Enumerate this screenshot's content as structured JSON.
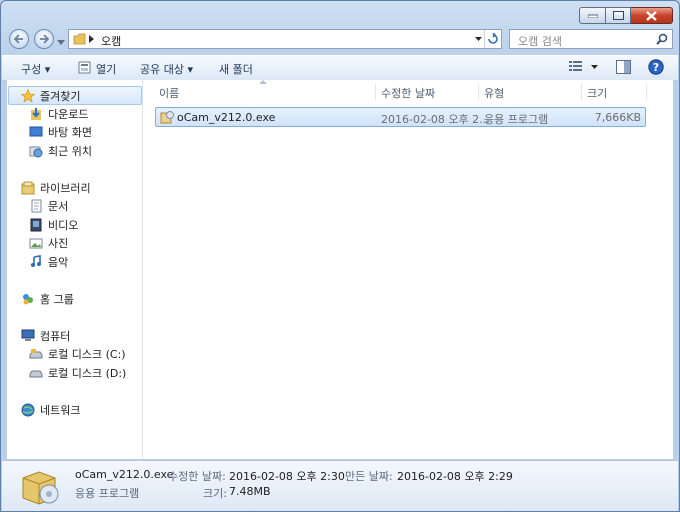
{
  "window": {
    "path_folder": "오캠"
  },
  "search": {
    "placeholder": "오캠 검색"
  },
  "toolbar": {
    "organize": "구성 ▾",
    "open": "열기",
    "share": "공유 대상 ▾",
    "new_folder": "새 폴더"
  },
  "nav": {
    "favorites": "즐겨찾기",
    "downloads": "다운로드",
    "desktop": "바탕 화면",
    "recent": "최근 위치",
    "libraries": "라이브러리",
    "documents": "문서",
    "videos": "비디오",
    "pictures": "사진",
    "music": "음악",
    "homegroup": "홈 그룹",
    "computer": "컴퓨터",
    "drive_c": "로컬 디스크 (C:)",
    "drive_d": "로컬 디스크 (D:)",
    "network": "네트워크"
  },
  "columns": {
    "name": "이름",
    "modified": "수정한 날짜",
    "type": "유형",
    "size": "크기"
  },
  "files": [
    {
      "name": "oCam_v212.0.exe",
      "modified": "2016-02-08 오후 2...",
      "type": "응용 프로그램",
      "size": "7,666KB"
    }
  ],
  "details": {
    "name": "oCam_v212.0.exe",
    "type": "응용 프로그램",
    "modified_label": "수정한 날짜:",
    "modified_value": "2016-02-08 오후 2:30",
    "created_label": "만든 날짜:",
    "created_value": "2016-02-08 오후 2:29",
    "size_label": "크기:",
    "size_value": "7.48MB"
  }
}
